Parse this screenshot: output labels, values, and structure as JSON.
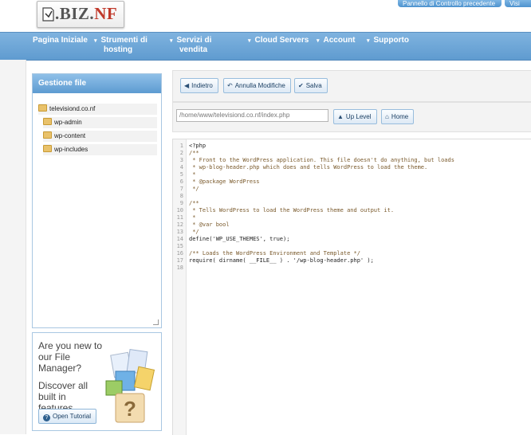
{
  "logo": {
    "text_main": ".BIZ.",
    "text_accent": "NF"
  },
  "top_links": [
    "Pannello di Controllo precedente",
    "Visi"
  ],
  "nav": {
    "items": [
      {
        "label_line1": "Pagina Iniziale",
        "label_line2": ""
      },
      {
        "label_line1": "Strumenti di",
        "label_line2": "hosting"
      },
      {
        "label_line1": "Servizi di",
        "label_line2": "vendita"
      },
      {
        "label_line1": "Cloud Servers",
        "label_line2": ""
      },
      {
        "label_line1": "Account",
        "label_line2": ""
      },
      {
        "label_line1": "Supporto",
        "label_line2": ""
      }
    ]
  },
  "file_panel": {
    "title": "Gestione file",
    "root": "televisiond.co.nf",
    "folders": [
      "wp-admin",
      "wp-content",
      "wp-includes"
    ]
  },
  "promo": {
    "line1": "Are you new to our File Manager?",
    "line2": "Discover all built in features.",
    "button": "Open Tutorial"
  },
  "toolbar": {
    "back": "Indietro",
    "undo": "Annulla Modifiche",
    "save": "Salva"
  },
  "path_bar": {
    "path_value": "/home/www/televisiond.co.nf/index.php",
    "up_level": "Up Level",
    "home": "Home"
  },
  "editor": {
    "lines": [
      "<?php",
      "/**",
      " * Front to the WordPress application. This file doesn't do anything, but loads",
      " * wp-blog-header.php which does and tells WordPress to load the theme.",
      " *",
      " * @package WordPress",
      " */",
      "",
      "/**",
      " * Tells WordPress to load the WordPress theme and output it.",
      " *",
      " * @var bool",
      " */",
      "define('WP_USE_THEMES', true);",
      "",
      "/** Loads the WordPress Environment and Template */",
      "require( dirname( __FILE__ ) . '/wp-blog-header.php' );",
      ""
    ],
    "line_numbers": [
      "1",
      "2",
      "3",
      "4",
      "5",
      "6",
      "7",
      "8",
      "9",
      "10",
      "11",
      "12",
      "13",
      "14",
      "15",
      "16",
      "17",
      "18"
    ]
  },
  "colors": {
    "nav_blue": "#6aa5d8",
    "accent_red": "#c0392b",
    "panel_border": "#a9c7e2"
  }
}
